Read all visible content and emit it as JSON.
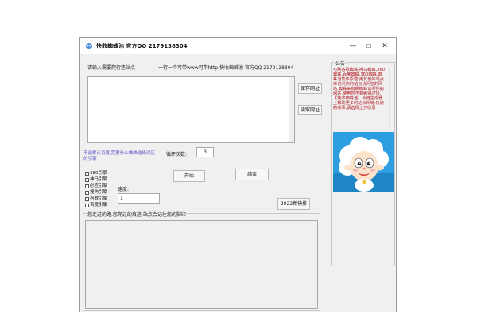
{
  "window": {
    "title": "快收蜘蛛池   官方QQ 2179138304",
    "controls": {
      "minimize": "—",
      "maximize": "☐",
      "close": "✕"
    }
  },
  "main": {
    "url_prompt": "请输入需要爬行垫站点",
    "url_hint": "一行一个可带www可带http 快收蜘蛛池   官方QQ 2179138304",
    "save_button": "保存网址",
    "load_button": "读取网址",
    "loop_label": "循环次数:",
    "loop_value": "3",
    "engine_hint": "不选默认百度,需要什么蜘蛛选择对应的引擎",
    "engines": [
      "360引擎",
      "神马引擎",
      "必应引擎",
      "搜狗引擎",
      "谷歌引擎",
      "百度引擎"
    ],
    "speed_label": "速度:",
    "speed_value": "1",
    "start_button": "开始",
    "stop_button": "结束",
    "new_button": "2022新快排",
    "log_title": "您走过的路,您爬过的痕迹,站点会记住您的脚印"
  },
  "notice": {
    "title": "公告",
    "text": "可刷谷歌蜘蛛,神马蜘蛛,360蜘蛛,百度蜘蛛,360蜘蛛,蜘蛛池软件原理:用其他的站点来访问你的站点访问您的网站,蜘蛛来有新蜘蛛访问你的网站,使用时不要刷得过快,【快收蜘蛛池】外链生成器上帮助更多的站长外链,快速的收录,请选择上方收录"
  },
  "colors": {
    "notice_text": "#b0141c",
    "hint_text": "#5a4fc8"
  }
}
